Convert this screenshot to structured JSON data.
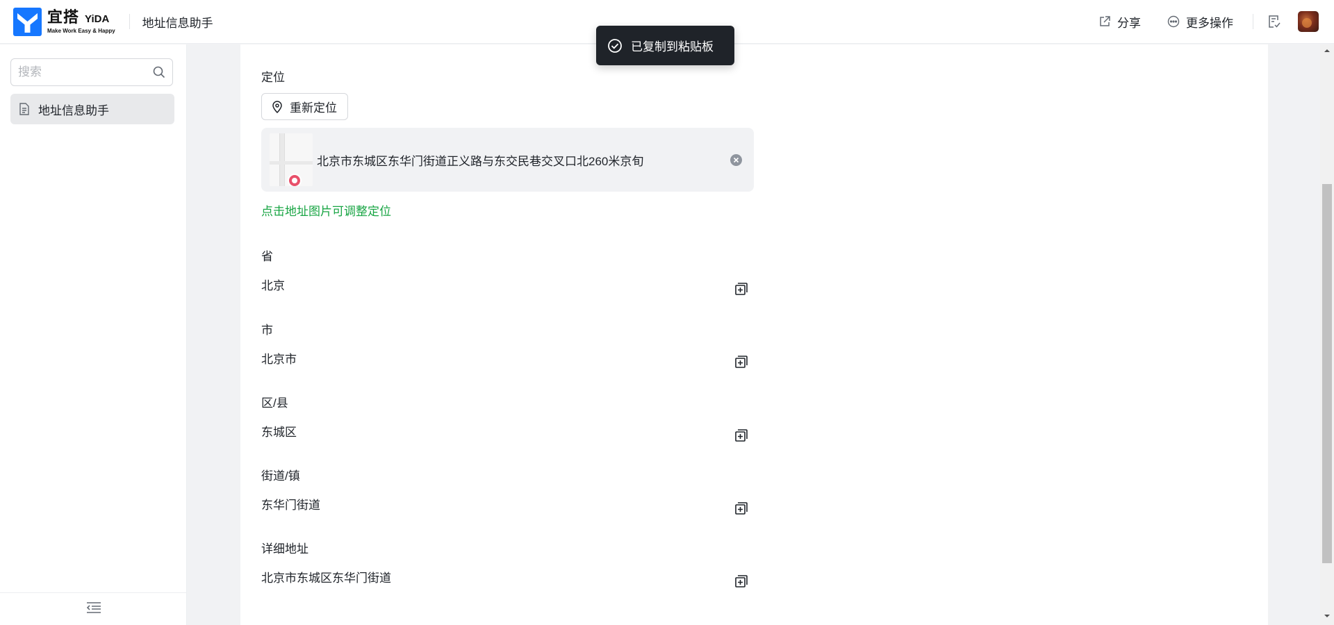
{
  "header": {
    "logo_cn": "宜搭",
    "logo_en": "YiDA",
    "logo_sub": "Make Work Easy & Happy",
    "app_title": "地址信息助手",
    "share_label": "分享",
    "more_label": "更多操作",
    "brand_color": "#1677ff"
  },
  "sidebar": {
    "search_placeholder": "搜索",
    "items": [
      {
        "label": "地址信息助手",
        "selected": true
      }
    ]
  },
  "form": {
    "location_label": "定位",
    "relocate_label": "重新定位",
    "address_text": "北京市东城区东华门街道正义路与东交民巷交叉口北260米京旬",
    "map_hint": "点击地址图片可调整定位",
    "hint_color": "#19a544",
    "fields": [
      {
        "label": "省",
        "value": "北京"
      },
      {
        "label": "市",
        "value": "北京市"
      },
      {
        "label": "区/县",
        "value": "东城区"
      },
      {
        "label": "街道/镇",
        "value": "东华门街道"
      },
      {
        "label": "详细地址",
        "value": "北京市东城区东华门街道"
      }
    ]
  },
  "toast": {
    "message": "已复制到粘贴板"
  }
}
